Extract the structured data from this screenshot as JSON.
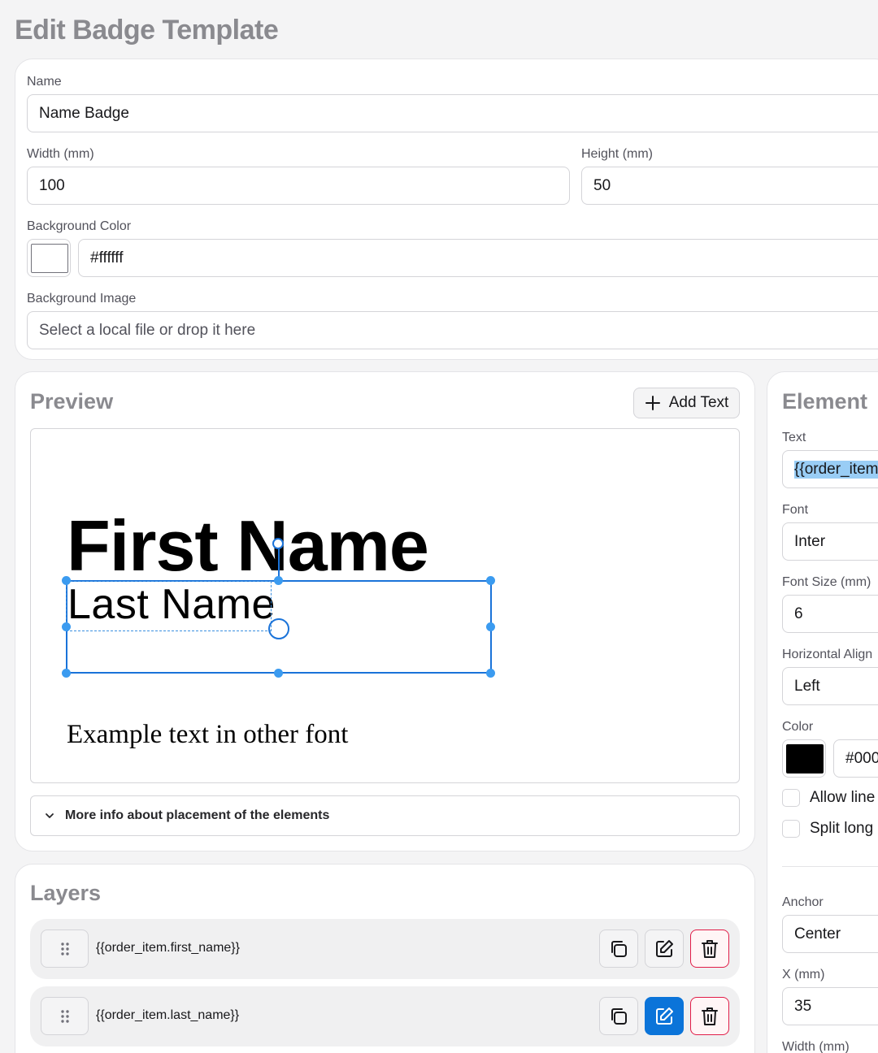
{
  "page": {
    "title": "Edit Badge Template"
  },
  "settings": {
    "name_label": "Name",
    "name_value": "Name Badge",
    "width_label": "Width (mm)",
    "width_value": "100",
    "height_label": "Height (mm)",
    "height_value": "50",
    "bg_color_label": "Background Color",
    "bg_color_value": "#ffffff",
    "bg_image_label": "Background Image",
    "bg_image_placeholder": "Select a local file or drop it here"
  },
  "preview": {
    "title": "Preview",
    "add_text_label": "Add Text",
    "first_name": "First Name",
    "last_name": "Last Name",
    "other_font_text": "Example text in other font",
    "details_label": "More info about placement of the elements"
  },
  "layers": {
    "title": "Layers",
    "items": [
      {
        "text": "{{order_item.first_name}}",
        "editing": false
      },
      {
        "text": "{{order_item.last_name}}",
        "editing": true
      }
    ]
  },
  "element": {
    "title": "Element",
    "text_label": "Text",
    "text_value": "{{order_item",
    "font_label": "Font",
    "font_value": "Inter",
    "font_size_label": "Font Size (mm)",
    "font_size_value": "6",
    "halign_label": "Horizontal Align",
    "halign_value": "Left",
    "color_label": "Color",
    "color_value": "#000",
    "color_swatch": "#000000",
    "allow_line_label": "Allow line",
    "split_long_label": "Split long",
    "anchor_label": "Anchor",
    "anchor_value": "Center",
    "x_label": "X (mm)",
    "x_value": "35",
    "width_label": "Width (mm)"
  },
  "colors": {
    "accent": "#0b74d9",
    "selection": "#1a73d9",
    "danger": "#e11d48",
    "heading_gray": "#8a8a8f"
  }
}
